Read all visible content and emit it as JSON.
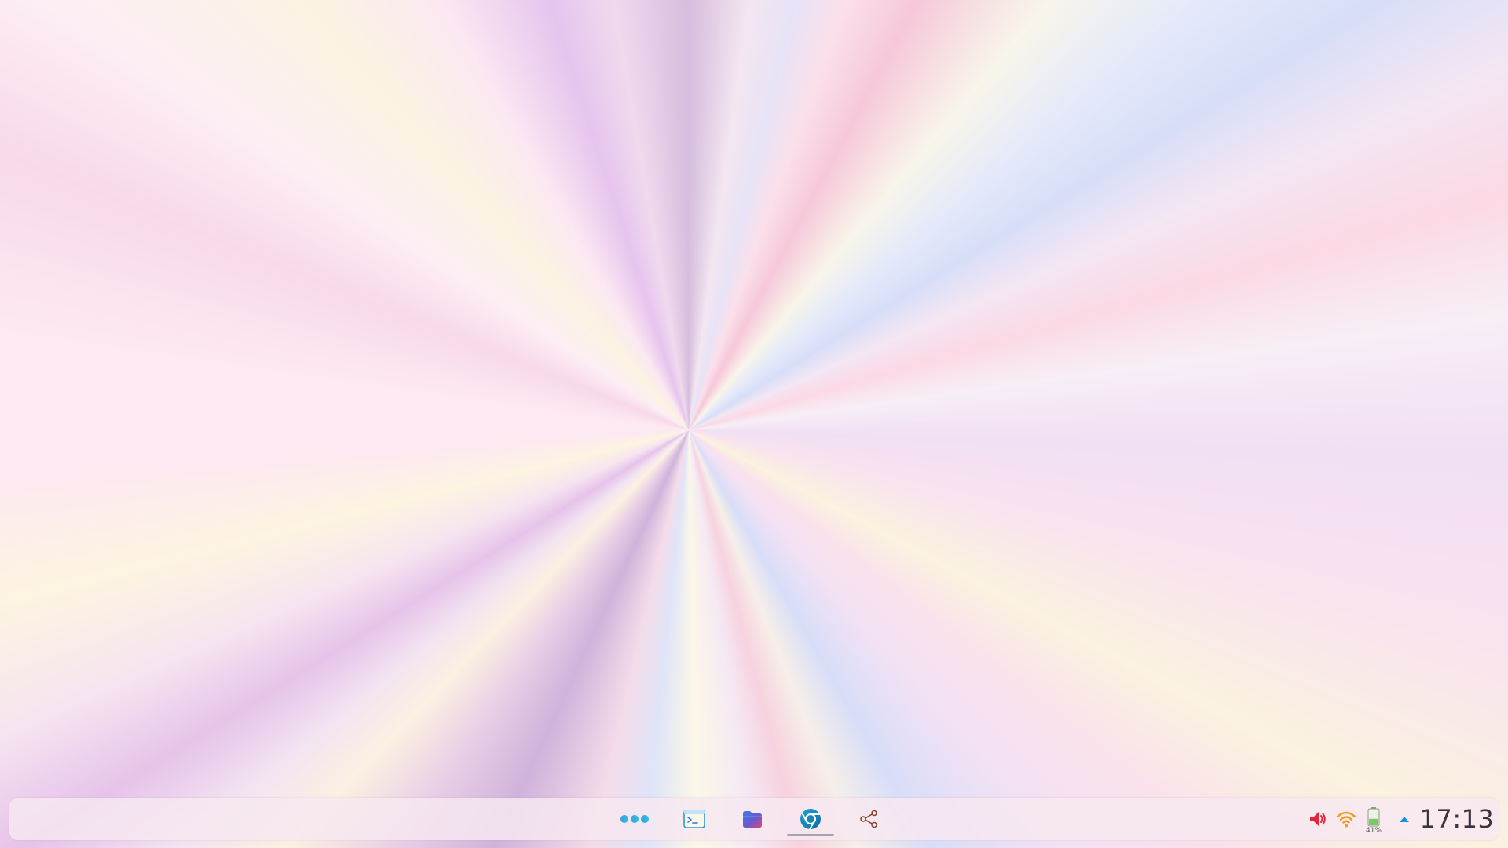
{
  "desktop": {
    "wallpaper": "pastel-radial-burst"
  },
  "taskbar": {
    "apps": [
      {
        "name": "launcher",
        "icon": "app-launcher-dots-icon",
        "active": false
      },
      {
        "name": "terminal",
        "icon": "terminal-icon",
        "active": false
      },
      {
        "name": "files",
        "icon": "folder-icon",
        "active": false
      },
      {
        "name": "browser",
        "icon": "browser-icon",
        "active": true
      },
      {
        "name": "share",
        "icon": "share-icon",
        "active": false
      }
    ],
    "tray": {
      "volume": {
        "icon": "volume-icon",
        "color": "#e0243c"
      },
      "wifi": {
        "icon": "wifi-icon",
        "color": "#f29a1e"
      },
      "battery": {
        "icon": "battery-icon",
        "percent": "41%",
        "level": 0.41,
        "color": "#7bc86c"
      },
      "expand": {
        "icon": "chevron-up-icon",
        "color": "#1e8fe0"
      },
      "clock": "17:13"
    },
    "colors": {
      "accent": "#2b9ad8",
      "indicator": "#a2a6b2"
    }
  }
}
